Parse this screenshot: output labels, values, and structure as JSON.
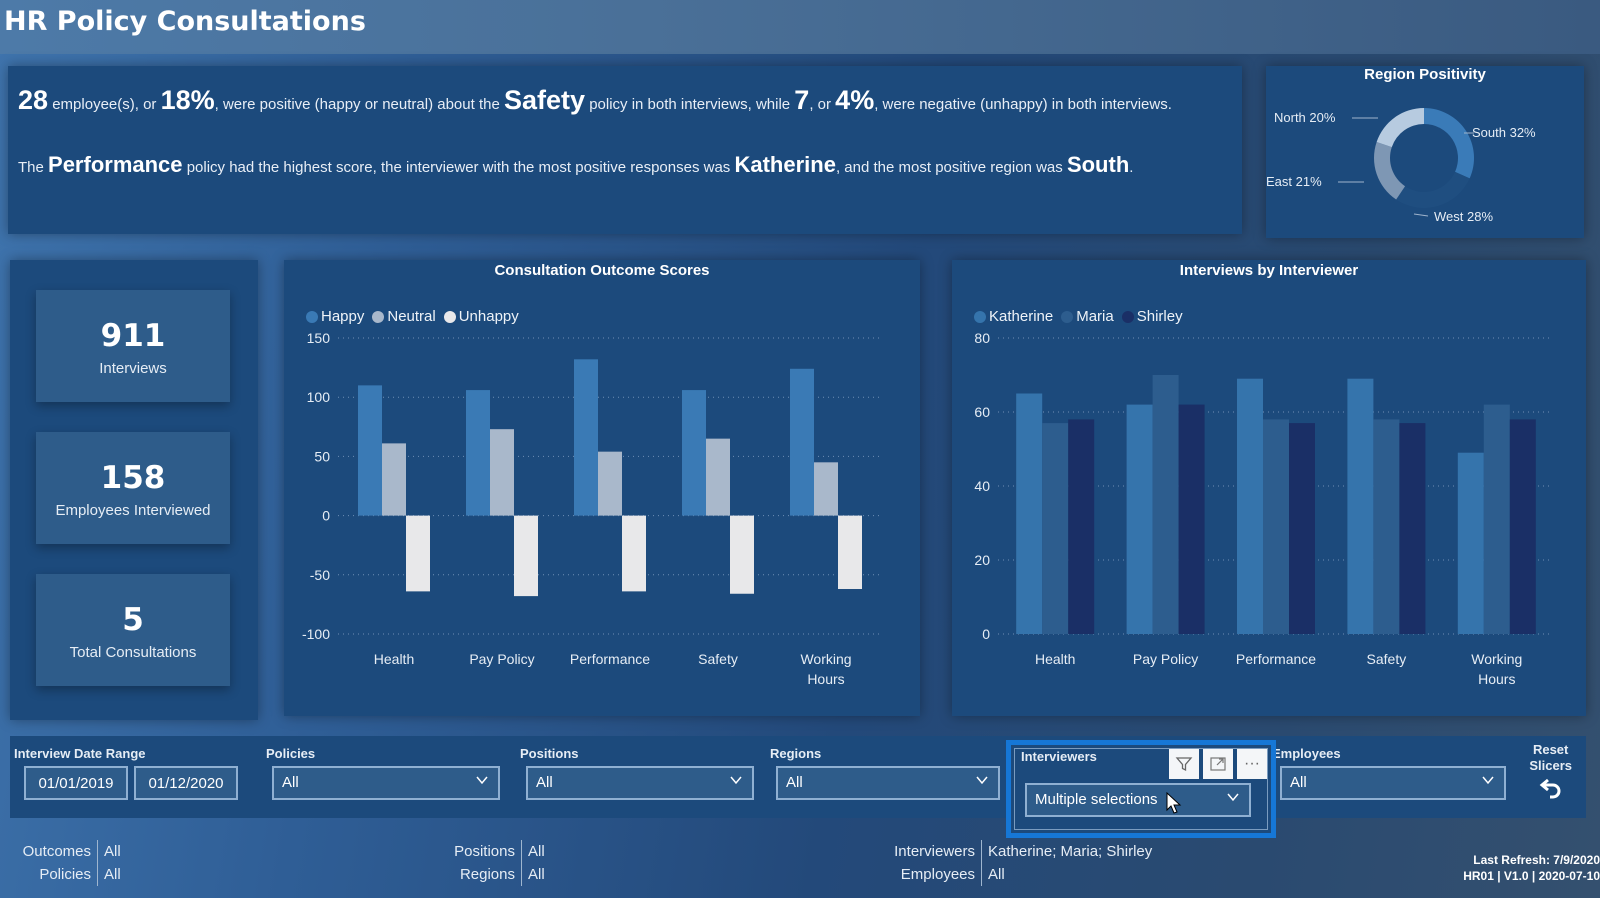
{
  "header": {
    "title": "HR Policy Consultations"
  },
  "summary": {
    "line1": {
      "count": "28",
      "t1": " employee(s), or ",
      "pct": "18%",
      "t2": ", were positive (happy or neutral) about the ",
      "policy": "Safety",
      "t3": " policy in both interviews, while ",
      "neg_count": "7",
      "t4": ", or ",
      "neg_pct": "4%",
      "t5": ", were negative (unhappy) in both interviews."
    },
    "line2": {
      "t1": "The ",
      "policy": "Performance",
      "t2": " policy had the highest score, the interviewer with the most positive responses was ",
      "interviewer": "Katherine",
      "t3": ", and the most positive region was ",
      "region": "South",
      "t4": "."
    }
  },
  "region_positivity": {
    "title": "Region Positivity",
    "slices": [
      {
        "label": "South 32%",
        "name": "South",
        "value": 32,
        "color": "#3a7bb8"
      },
      {
        "label": "West 28%",
        "name": "West",
        "value": 28,
        "color": "#1f4e80"
      },
      {
        "label": "East 21%",
        "name": "East",
        "value": 21,
        "color": "#7e97b4"
      },
      {
        "label": "North 20%",
        "name": "North",
        "value": 20,
        "color": "#b7cbe0"
      }
    ]
  },
  "kpis": [
    {
      "value": "911",
      "label": "Interviews"
    },
    {
      "value": "158",
      "label": "Employees Interviewed"
    },
    {
      "value": "5",
      "label": "Total Consultations"
    }
  ],
  "chart_data": [
    {
      "type": "bar",
      "title": "Consultation Outcome Scores",
      "categories": [
        "Health",
        "Pay Policy",
        "Performance",
        "Safety",
        "Working Hours"
      ],
      "series": [
        {
          "name": "Happy",
          "color": "#3a7ab5",
          "values": [
            110,
            106,
            132,
            106,
            124
          ]
        },
        {
          "name": "Neutral",
          "color": "#a9b8cb",
          "values": [
            61,
            73,
            54,
            65,
            45
          ]
        },
        {
          "name": "Unhappy",
          "color": "#e8e8ea",
          "values": [
            -64,
            -68,
            -64,
            -66,
            -62
          ]
        }
      ],
      "yticks": [
        150,
        100,
        50,
        0,
        -50,
        -100
      ],
      "ylim": [
        -100,
        150
      ],
      "grid": true,
      "legend": "top-left",
      "xlabel": "",
      "ylabel": ""
    },
    {
      "type": "bar",
      "title": "Interviews by Interviewer",
      "categories": [
        "Health",
        "Pay Policy",
        "Performance",
        "Safety",
        "Working Hours"
      ],
      "series": [
        {
          "name": "Katherine",
          "color": "#3574ac",
          "values": [
            65,
            62,
            69,
            69,
            49
          ]
        },
        {
          "name": "Maria",
          "color": "#2d5d8e",
          "values": [
            57,
            70,
            58,
            58,
            62
          ]
        },
        {
          "name": "Shirley",
          "color": "#1a2f66",
          "values": [
            58,
            62,
            57,
            57,
            58
          ]
        }
      ],
      "yticks": [
        80,
        60,
        40,
        20,
        0
      ],
      "ylim": [
        0,
        80
      ],
      "grid": true,
      "legend": "top-left",
      "xlabel": "",
      "ylabel": ""
    }
  ],
  "slicers": {
    "date": {
      "label": "Interview Date Range",
      "start": "01/01/2019",
      "end": "01/12/2020"
    },
    "policies": {
      "label": "Policies",
      "value": "All"
    },
    "positions": {
      "label": "Positions",
      "value": "All"
    },
    "regions": {
      "label": "Regions",
      "value": "All"
    },
    "interviewers": {
      "label": "Interviewers",
      "value": "Multiple selections",
      "more": "···"
    },
    "employees": {
      "label": "Employees",
      "value": "All"
    },
    "reset": {
      "label_line1": "Reset",
      "label_line2": "Slicers"
    }
  },
  "footer": {
    "filters": [
      {
        "key": "Outcomes",
        "value": "All"
      },
      {
        "key": "Policies",
        "value": "All"
      },
      {
        "key": "Positions",
        "value": "All"
      },
      {
        "key": "Regions",
        "value": "All"
      },
      {
        "key": "Interviewers",
        "value": "Katherine; Maria; Shirley"
      },
      {
        "key": "Employees",
        "value": "All"
      }
    ],
    "last_refresh": "Last Refresh: 7/9/2020",
    "version": "HR01 | V1.0 | 2020-07-10"
  }
}
